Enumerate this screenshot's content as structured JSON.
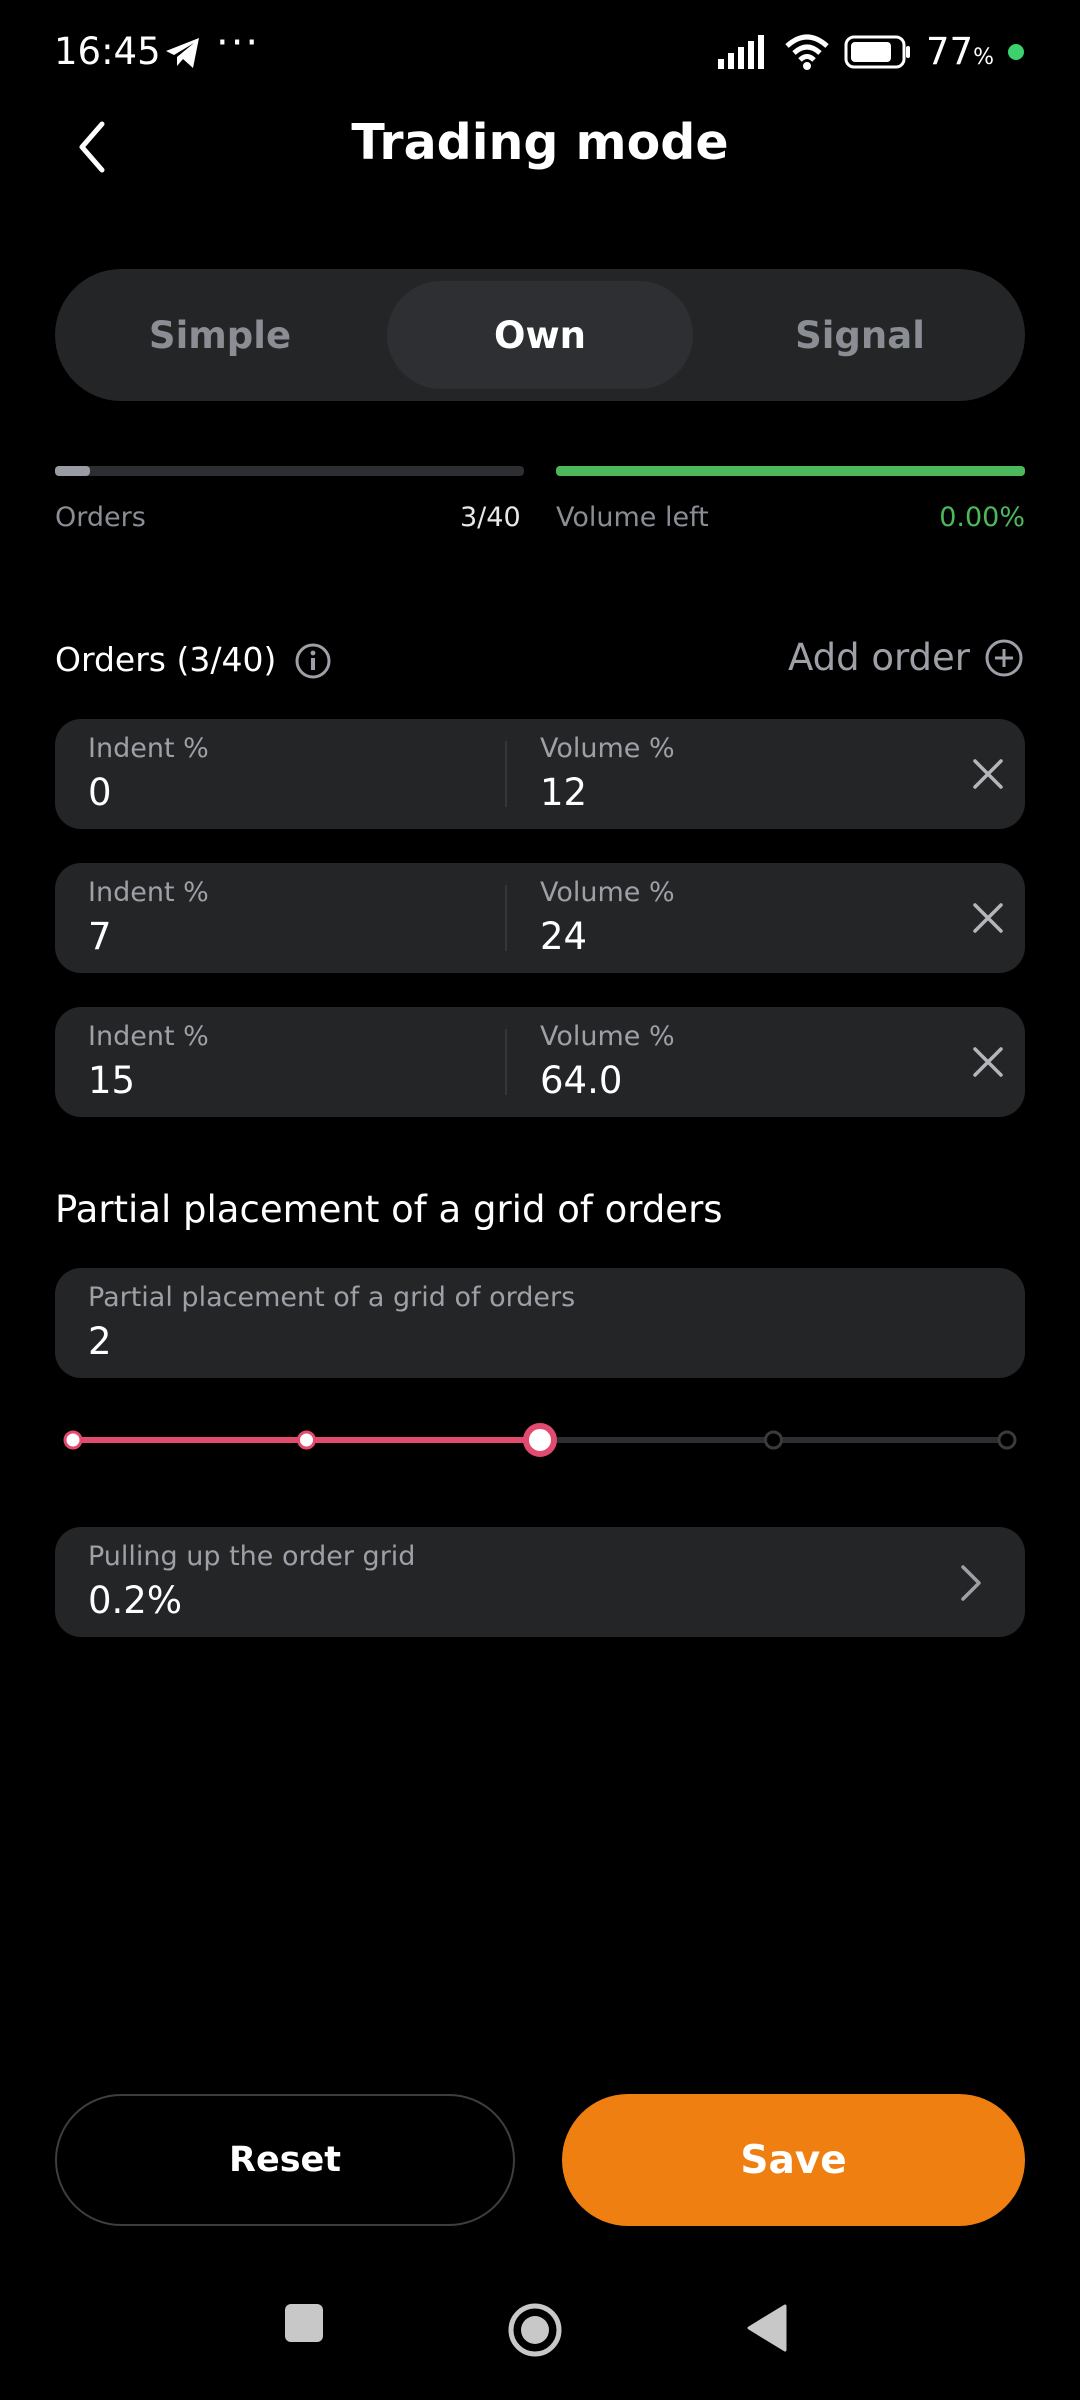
{
  "status_bar": {
    "time": "16:45",
    "dots": "···",
    "battery_value": "77",
    "battery_unit": "%"
  },
  "header": {
    "title": "Trading mode"
  },
  "tabs": [
    {
      "label": "Simple",
      "active": false
    },
    {
      "label": "Own",
      "active": true
    },
    {
      "label": "Signal",
      "active": false
    }
  ],
  "progress": {
    "orders_label": "Orders",
    "orders_value": "3/40",
    "orders_fraction": 0.075,
    "volume_label": "Volume left",
    "volume_value": "0.00%",
    "volume_fraction": 1.0
  },
  "orders_section": {
    "title": "Orders (3/40)",
    "add_label": "Add order"
  },
  "orders": [
    {
      "indent_label": "Indent %",
      "indent_value": "0",
      "volume_label": "Volume %",
      "volume_value": "12"
    },
    {
      "indent_label": "Indent %",
      "indent_value": "7",
      "volume_label": "Volume %",
      "volume_value": "24"
    },
    {
      "indent_label": "Indent %",
      "indent_value": "15",
      "volume_label": "Volume %",
      "volume_value": "64.0"
    }
  ],
  "partial": {
    "section_title": "Partial placement of a grid of orders",
    "field_label": "Partial placement of a grid of orders",
    "field_value": "2",
    "slider_steps": 5,
    "slider_selected_index": 2
  },
  "pulling": {
    "label": "Pulling up the order grid",
    "value": "0.2%"
  },
  "buttons": {
    "reset": "Reset",
    "save": "Save"
  },
  "colors": {
    "accent_pink": "#e24a6e",
    "save_orange": "#ee7f10",
    "volume_green": "#4cb85c",
    "card_bg": "#242527"
  }
}
